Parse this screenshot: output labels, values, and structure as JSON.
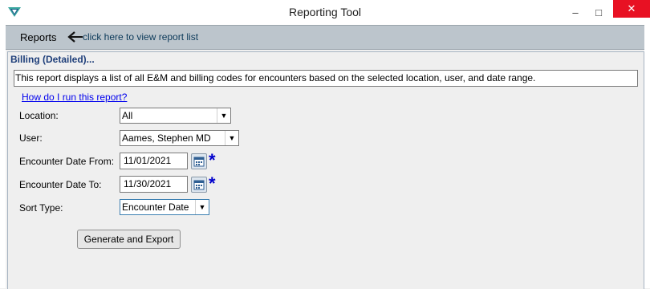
{
  "window": {
    "title": "Reporting Tool",
    "minimize_glyph": "–",
    "maximize_glyph": "□",
    "close_glyph": "✕",
    "app_icon": "app-logo-icon"
  },
  "toolbar": {
    "reports_label": "Reports",
    "back_icon": "arrow-left-icon",
    "link_text": "click here to view report list"
  },
  "report": {
    "title": "Billing (Detailed)...",
    "description": "This report displays a list of all E&M and billing codes for encounters based on the selected location, user, and date range.",
    "howto_link": "How do I run this report?"
  },
  "form": {
    "location": {
      "label": "Location:",
      "value": "All"
    },
    "user": {
      "label": "User:",
      "value": "Aames, Stephen MD"
    },
    "date_from": {
      "label": "Encounter Date From:",
      "value": "11/01/2021",
      "required": "*"
    },
    "date_to": {
      "label": "Encounter Date To:",
      "value": "11/30/2021",
      "required": "*"
    },
    "sort_type": {
      "label": "Sort Type:",
      "value": "Encounter Date"
    },
    "dropdown_glyph": "▼",
    "generate_button": "Generate and Export"
  },
  "colors": {
    "toolbar_bg": "#bcc5cc",
    "panel_title": "#1f3f7a",
    "link": "#0000ee",
    "required_marker": "#0000cc",
    "close_button": "#e81123"
  }
}
